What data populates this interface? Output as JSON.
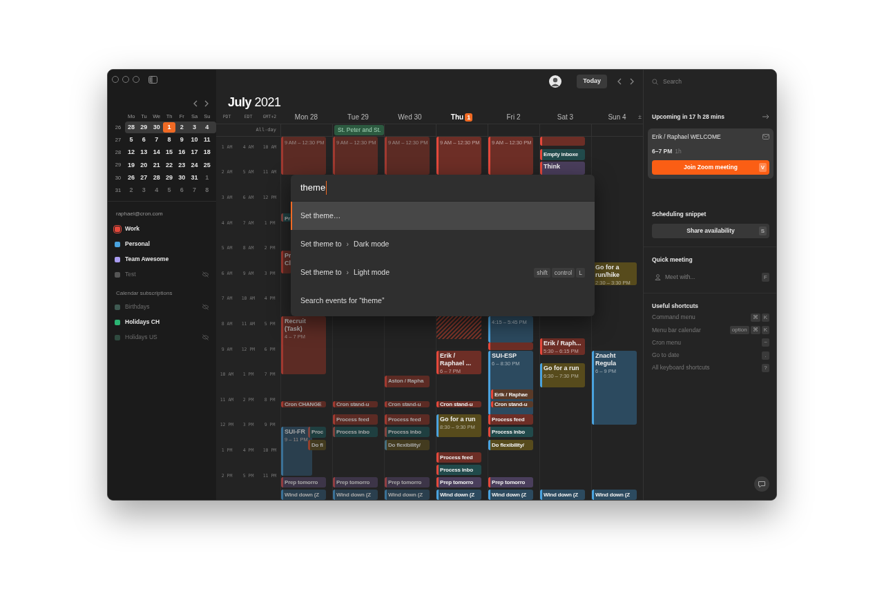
{
  "sidebar": {
    "mini_calendar": {
      "weekdays": [
        "Mo",
        "Tu",
        "We",
        "Th",
        "Fr",
        "Sa",
        "Su"
      ],
      "weeks": [
        {
          "number": "26",
          "current": true,
          "days": [
            {
              "label": "28"
            },
            {
              "label": "29"
            },
            {
              "label": "30"
            },
            {
              "label": "1",
              "today": true
            },
            {
              "label": "2"
            },
            {
              "label": "3"
            },
            {
              "label": "4"
            }
          ]
        },
        {
          "number": "27",
          "current": false,
          "days": [
            {
              "label": "5"
            },
            {
              "label": "6"
            },
            {
              "label": "7"
            },
            {
              "label": "8"
            },
            {
              "label": "9"
            },
            {
              "label": "10"
            },
            {
              "label": "11"
            }
          ]
        },
        {
          "number": "28",
          "current": false,
          "days": [
            {
              "label": "12"
            },
            {
              "label": "13"
            },
            {
              "label": "14"
            },
            {
              "label": "15"
            },
            {
              "label": "16"
            },
            {
              "label": "17"
            },
            {
              "label": "18"
            }
          ]
        },
        {
          "number": "29",
          "current": false,
          "days": [
            {
              "label": "19"
            },
            {
              "label": "20"
            },
            {
              "label": "21"
            },
            {
              "label": "22"
            },
            {
              "label": "23"
            },
            {
              "label": "24"
            },
            {
              "label": "25"
            }
          ]
        },
        {
          "number": "30",
          "current": false,
          "days": [
            {
              "label": "26"
            },
            {
              "label": "27"
            },
            {
              "label": "28"
            },
            {
              "label": "29"
            },
            {
              "label": "30"
            },
            {
              "label": "31"
            },
            {
              "label": "1",
              "outside": true
            }
          ]
        },
        {
          "number": "31",
          "current": false,
          "days": [
            {
              "label": "2",
              "outside": true
            },
            {
              "label": "3",
              "outside": true
            },
            {
              "label": "4",
              "outside": true
            },
            {
              "label": "5",
              "outside": true
            },
            {
              "label": "6",
              "outside": true
            },
            {
              "label": "7",
              "outside": true
            },
            {
              "label": "8",
              "outside": true
            }
          ]
        }
      ]
    },
    "account": "raphael@cron.com",
    "calendars": [
      {
        "label": "Work",
        "color": "#e5483b",
        "visible": true,
        "selected": true
      },
      {
        "label": "Personal",
        "color": "#4aa3df",
        "visible": true,
        "selected": false
      },
      {
        "label": "Team Awesome",
        "color": "#a99cf0",
        "visible": true,
        "selected": false
      },
      {
        "label": "Test",
        "color": "#555555",
        "visible": false,
        "selected": false
      }
    ],
    "subscriptions_title": "Calendar subscriptions",
    "subscriptions": [
      {
        "label": "Birthdays",
        "color": "#3f5a52",
        "visible": false,
        "selected": false
      },
      {
        "label": "Holidays CH",
        "color": "#2bb573",
        "visible": true,
        "selected": false
      },
      {
        "label": "Holidays US",
        "color": "#2f4a3f",
        "visible": false,
        "selected": false
      }
    ]
  },
  "toolbar": {
    "today": "Today"
  },
  "calendar": {
    "title": "**July** 2021",
    "timezones": [
      "PDT",
      "EDT",
      "GMT+2"
    ],
    "expand": "±",
    "allday_label": "All-day",
    "hours": [
      [
        "1 AM",
        "4 AM",
        "10 AM"
      ],
      [
        "2 AM",
        "5 AM",
        "11 AM"
      ],
      [
        "3 AM",
        "6 AM",
        "12 PM"
      ],
      [
        "4 AM",
        "7 AM",
        "1 PM"
      ],
      [
        "5 AM",
        "8 AM",
        "2 PM"
      ],
      [
        "6 AM",
        "9 AM",
        "3 PM"
      ],
      [
        "7 AM",
        "10 AM",
        "4 PM"
      ],
      [
        "8 AM",
        "11 AM",
        "5 PM"
      ],
      [
        "9 AM",
        "12 PM",
        "6 PM"
      ],
      [
        "10 AM",
        "1 PM",
        "7 PM"
      ],
      [
        "11 AM",
        "2 PM",
        "8 PM"
      ],
      [
        "12 PM",
        "3 PM",
        "9 PM"
      ],
      [
        "1 PM",
        "4 PM",
        "10 PM"
      ],
      [
        "2 PM",
        "5 PM",
        "11 PM"
      ]
    ],
    "days": [
      {
        "weekday": "Mon",
        "date": "28",
        "today": false,
        "past": true,
        "events": [
          {
            "kind": "work",
            "time": "9 AM – 12:30 PM",
            "color": "#5c2b24"
          },
          {
            "kind": "work",
            "title": "Pr",
            "color": "#1f3f40"
          },
          {
            "kind": "work",
            "title": "Pr Cl",
            "color": "#5c2b24"
          },
          {
            "kind": "work",
            "title": "Recruit (Task)",
            "time": "4 – 7 PM",
            "color": "#5c2b24"
          },
          {
            "kind": "work",
            "title": "Cron CHANGE",
            "color": "#5c2b24"
          },
          {
            "kind": "personal",
            "title": "SUI-FR",
            "time": "9 – 11 PM",
            "color": "#2a3f4e"
          },
          {
            "kind": "work",
            "title": "Proc",
            "color": "#1f3f40"
          },
          {
            "kind": "work",
            "title": "Do fl",
            "color": "#433b1f"
          },
          {
            "kind": "work",
            "title": "Prep tomorro",
            "color": "#3d3548"
          },
          {
            "kind": "personal",
            "title": "Wind down (Z",
            "color": "#2a3f4e"
          }
        ]
      },
      {
        "weekday": "Tue",
        "date": "29",
        "today": false,
        "past": true,
        "allday": [
          {
            "title": "St. Peter and St.",
            "color": "#2c5a40"
          }
        ],
        "events": [
          {
            "kind": "work",
            "time": "9 AM – 12:30 PM",
            "color": "#5c2b24"
          },
          {
            "kind": "work",
            "title": "Cron stand-u",
            "color": "#5c2b24"
          },
          {
            "kind": "work",
            "title": "Process feed",
            "color": "#5c2b24"
          },
          {
            "kind": "work",
            "title": "Process inbo",
            "color": "#1f3f40"
          },
          {
            "kind": "work",
            "title": "Prep tomorro",
            "color": "#3d3548"
          },
          {
            "kind": "personal",
            "title": "Wind down (Z",
            "color": "#2a3f4e"
          }
        ]
      },
      {
        "weekday": "Wed",
        "date": "30",
        "today": false,
        "past": true,
        "events": [
          {
            "kind": "work",
            "time": "9 AM – 12:30 PM",
            "color": "#5c2b24"
          },
          {
            "kind": "work",
            "title": "Aston / Rapha",
            "color": "#5c2b24"
          },
          {
            "kind": "work",
            "title": "Cron stand-u",
            "color": "#5c2b24"
          },
          {
            "kind": "work",
            "title": "Process feed",
            "color": "#5c2b24"
          },
          {
            "kind": "work",
            "title": "Process inbo",
            "color": "#1f3f40"
          },
          {
            "kind": "personal",
            "title": "Do flexibility/",
            "color": "#433b1f"
          },
          {
            "kind": "work",
            "title": "Prep tomorro",
            "color": "#3d3548"
          },
          {
            "kind": "personal",
            "title": "Wind down (Z",
            "color": "#2a3f4e"
          }
        ]
      },
      {
        "weekday": "Thu",
        "date": "1",
        "today": true,
        "past": false,
        "events": [
          {
            "kind": "work",
            "time": "9 AM – 12:30 PM",
            "color": "#6d2e26"
          },
          {
            "kind": "hatched",
            "color": "#7a3328"
          },
          {
            "kind": "work",
            "title": "Erik / Raphael ...",
            "time": "6 – 7 PM",
            "color": "#6d2e26"
          },
          {
            "kind": "work",
            "title": "Cron stand-u",
            "color": "#6d2e26"
          },
          {
            "kind": "personal",
            "title": "Go for a run",
            "time": "8:30 – 9:30 PM",
            "color": "#574b1c"
          },
          {
            "kind": "work",
            "title": "Process feed",
            "color": "#6d2e26"
          },
          {
            "kind": "work",
            "title": "Process inbo",
            "color": "#214a4b"
          },
          {
            "kind": "work",
            "title": "Prep tomorro",
            "color": "#4a3e5c"
          },
          {
            "kind": "personal",
            "title": "Wind down (Z",
            "color": "#2c4a5f"
          }
        ]
      },
      {
        "weekday": "Fri",
        "date": "2",
        "today": false,
        "past": false,
        "events": [
          {
            "kind": "work",
            "time": "9 AM – 12:30 PM",
            "color": "#6d2e26"
          },
          {
            "kind": "work",
            "color": "#6d2e26"
          },
          {
            "kind": "personal",
            "time": "4:15 – 5:45 PM",
            "color": "#2c4a5f"
          },
          {
            "kind": "personal",
            "title": "SUI-ESP",
            "time": "6 – 8:30 PM",
            "color": "#2c4a5f"
          },
          {
            "kind": "work",
            "title": "Erik / Raphae",
            "color": "#5a3a28"
          },
          {
            "kind": "work",
            "title": "Cron stand-u",
            "color": "#5a3a28"
          },
          {
            "kind": "work",
            "title": "Process feed",
            "color": "#6d2e26"
          },
          {
            "kind": "work",
            "title": "Process inbo",
            "color": "#214a4b"
          },
          {
            "kind": "personal",
            "title": "Do flexibility/",
            "color": "#574b1c"
          },
          {
            "kind": "work",
            "title": "Prep tomorro",
            "color": "#4a3e5c"
          },
          {
            "kind": "personal",
            "title": "Wind down (Z",
            "color": "#2c4a5f"
          }
        ]
      },
      {
        "weekday": "Sat",
        "date": "3",
        "today": false,
        "past": false,
        "events": [
          {
            "kind": "work",
            "color": "#6d2e26"
          },
          {
            "kind": "work",
            "title": "Empty inboxe",
            "color": "#214a4b"
          },
          {
            "kind": "work",
            "title": "Think",
            "color": "#4a3e5c"
          },
          {
            "kind": "work",
            "title": "Erik / Raph...",
            "time": "5:30 – 6:15 PM",
            "color": "#6d2e26"
          },
          {
            "kind": "personal",
            "title": "Go for a run",
            "time": "6:30 – 7:30 PM",
            "color": "#574b1c"
          },
          {
            "kind": "personal",
            "title": "Wind down (Z",
            "color": "#2c4a5f"
          }
        ]
      },
      {
        "weekday": "Sun",
        "date": "4",
        "today": false,
        "past": false,
        "events": [
          {
            "kind": "other",
            "title": "Go for a run/hike",
            "time": "2:30 – 3:30 PM",
            "color": "#574b1c"
          },
          {
            "kind": "personal",
            "title": "Znacht Regula",
            "time": "6 – 9 PM",
            "color": "#2c4a5f"
          },
          {
            "kind": "personal",
            "title": "Wind down (Z",
            "color": "#2c4a5f"
          }
        ]
      }
    ]
  },
  "command_palette": {
    "query": "theme",
    "items": [
      {
        "label": "Set theme…",
        "selected": true
      },
      {
        "label": "Set theme to",
        "separator": "›",
        "target": "Dark mode",
        "selected": false
      },
      {
        "label": "Set theme to",
        "separator": "›",
        "target": "Light mode",
        "keys": [
          "shift",
          "control",
          "L"
        ],
        "selected": false
      },
      {
        "label": "Search events for “theme”",
        "selected": false
      }
    ]
  },
  "right_panel": {
    "search_placeholder": "Search",
    "upcoming": {
      "title": "Upcoming in 17 h 28 mins",
      "event": "Erik / Raphael WELCOME",
      "time": "6–7 PM",
      "duration": "1h",
      "button": "Join Zoom meeting",
      "key": "V"
    },
    "scheduling": {
      "title": "Scheduling snippet",
      "button": "Share availability",
      "key": "S"
    },
    "quick_meeting": {
      "title": "Quick meeting",
      "placeholder": "Meet with...",
      "key": "F"
    },
    "shortcuts": {
      "title": "Useful shortcuts",
      "items": [
        {
          "label": "Command menu",
          "keys": [
            "⌘",
            "K"
          ]
        },
        {
          "label": "Menu bar calendar",
          "keys": [
            "option",
            "⌘",
            "K"
          ]
        },
        {
          "label": "Cron menu",
          "keys": [
            "~"
          ]
        },
        {
          "label": "Go to date",
          "keys": [
            "."
          ]
        },
        {
          "label": "All keyboard shortcuts",
          "keys": [
            "?"
          ]
        }
      ]
    }
  }
}
